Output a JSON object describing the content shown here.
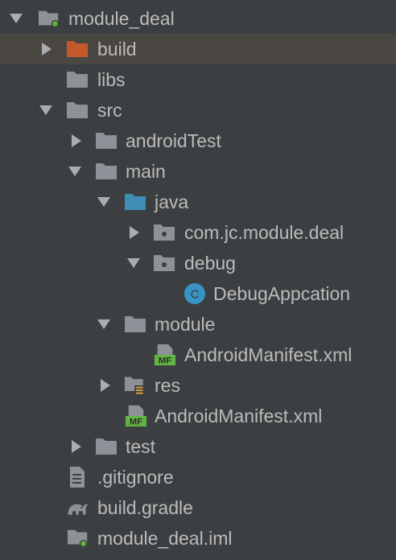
{
  "project_tree": {
    "root": {
      "label": "module_deal"
    },
    "build": {
      "label": "build"
    },
    "libs": {
      "label": "libs"
    },
    "src": {
      "label": "src"
    },
    "androidTest": {
      "label": "androidTest"
    },
    "main": {
      "label": "main"
    },
    "java": {
      "label": "java"
    },
    "package_module_deal": {
      "label": "com.jc.module.deal"
    },
    "package_debug": {
      "label": "debug"
    },
    "debug_app_class": {
      "label": "DebugAppcation",
      "icon_letter": "C"
    },
    "module": {
      "label": "module"
    },
    "module_manifest": {
      "label": "AndroidManifest.xml",
      "icon_text": "MF"
    },
    "res": {
      "label": "res"
    },
    "main_manifest": {
      "label": "AndroidManifest.xml",
      "icon_text": "MF"
    },
    "test": {
      "label": "test"
    },
    "gitignore": {
      "label": ".gitignore"
    },
    "build_gradle": {
      "label": "build.gradle"
    },
    "module_iml": {
      "label": "module_deal.iml"
    }
  },
  "colors": {
    "background": "#3c3f41",
    "selected_row": "#4a4642",
    "text": "#bbbbbb",
    "folder": "#8c9298",
    "excluded_folder": "#c4582b",
    "source_folder": "#3f8fb5",
    "class_icon": "#3794c5",
    "manifest_green": "#62b543",
    "module_dot": "#5fb832",
    "resource_bars": "#e2a83b"
  },
  "icons": {
    "expanded": "triangle-down-icon",
    "collapsed": "triangle-right-icon",
    "folder": "folder-icon",
    "module": "module-folder-icon",
    "package": "package-icon",
    "class": "class-icon",
    "manifest": "manifest-icon",
    "text_file": "text-file-icon",
    "gradle": "gradle-icon",
    "iml": "iml-file-icon"
  }
}
